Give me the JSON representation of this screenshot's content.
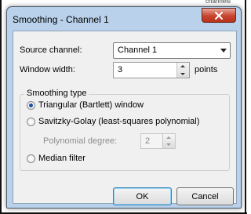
{
  "background": {
    "corner_text": "channels"
  },
  "window": {
    "title": "Smoothing - Channel 1",
    "close_glyph": "✕"
  },
  "form": {
    "source_channel_label": "Source channel:",
    "source_channel_value": "Channel 1",
    "window_width_label": "Window width:",
    "window_width_value": "3",
    "window_width_unit": "points"
  },
  "smoothing": {
    "group_label": "Smoothing type",
    "options": [
      {
        "label": "Triangular (Bartlett) window",
        "selected": true
      },
      {
        "label": "Savitzky-Golay (least-squares polynomial)",
        "selected": false
      },
      {
        "label": "Median filter",
        "selected": false
      }
    ],
    "polynomial_degree_label": "Polynomial degree:",
    "polynomial_degree_value": "2",
    "polynomial_degree_enabled": false
  },
  "buttons": {
    "ok": "OK",
    "cancel": "Cancel"
  },
  "colors": {
    "titlebar": "#b9d1ea",
    "client": "#f0f0f0",
    "close": "#c7442e",
    "radio_dot": "#1c4fa6"
  }
}
